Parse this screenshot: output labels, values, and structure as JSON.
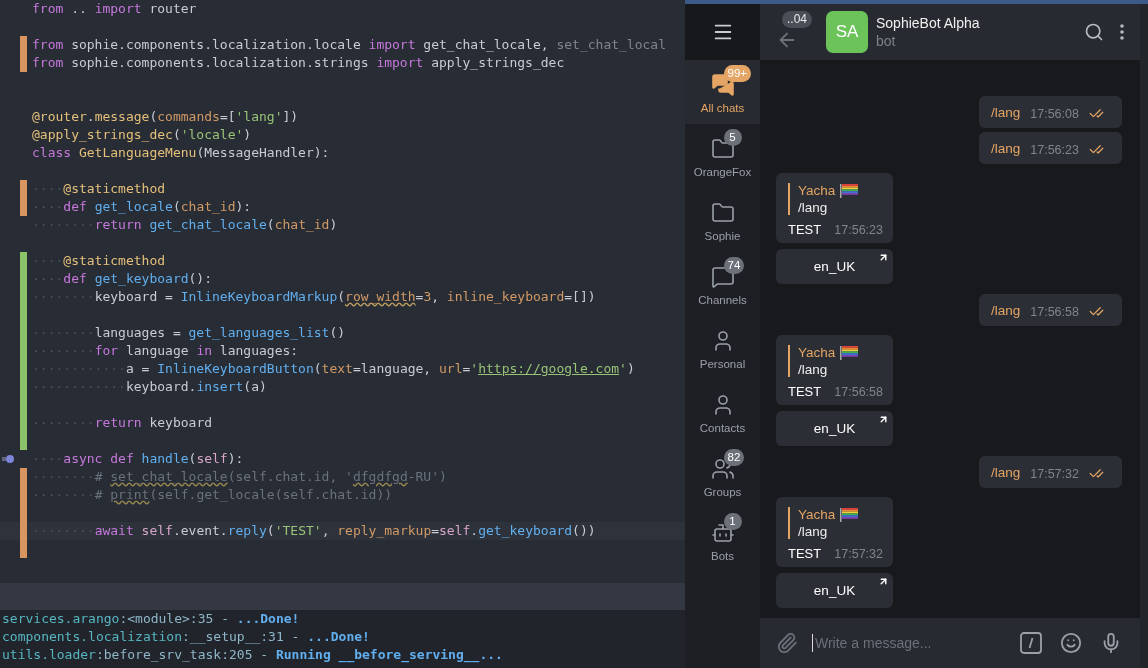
{
  "editor": {
    "lines": [
      {
        "kind": "unchanged",
        "tokens": [
          {
            "kind": "keyword",
            "text": "from"
          },
          {
            "kind": "name",
            "text": " .. "
          },
          {
            "kind": "keyword",
            "text": "import"
          },
          {
            "kind": "name",
            "text": " router"
          }
        ]
      },
      {
        "kind": "unchanged"
      },
      {
        "kind": "modified",
        "tokens": [
          {
            "kind": "keyword",
            "text": "from"
          },
          {
            "kind": "name",
            "text": " sophie.components.localization.locale "
          },
          {
            "kind": "keyword",
            "text": "import"
          },
          {
            "kind": "name",
            "text": " get_chat_locale, "
          },
          {
            "kind": "unused",
            "text": "set_chat_local"
          }
        ]
      },
      {
        "kind": "modified",
        "tokens": [
          {
            "kind": "keyword",
            "text": "from"
          },
          {
            "kind": "name",
            "text": " sophie.components.localization.strings "
          },
          {
            "kind": "keyword",
            "text": "import"
          },
          {
            "kind": "name",
            "text": " apply_strings_dec"
          }
        ]
      },
      {
        "kind": "unchanged"
      },
      {
        "kind": "unchanged"
      },
      {
        "kind": "unchanged",
        "tokens": [
          {
            "kind": "decorator",
            "text": "@router"
          },
          {
            "kind": "name",
            "text": "."
          },
          {
            "kind": "decorator",
            "text": "message"
          },
          {
            "kind": "name",
            "text": "("
          },
          {
            "kind": "parameter",
            "text": "commands"
          },
          {
            "kind": "name",
            "text": "=["
          },
          {
            "kind": "string",
            "text": "'lang'"
          },
          {
            "kind": "name",
            "text": "])"
          }
        ]
      },
      {
        "kind": "unchanged",
        "tokens": [
          {
            "kind": "decorator",
            "text": "@apply_strings_dec"
          },
          {
            "kind": "name",
            "text": "("
          },
          {
            "kind": "string",
            "text": "'locale'"
          },
          {
            "kind": "name",
            "text": ")"
          }
        ]
      },
      {
        "kind": "unchanged",
        "tokens": [
          {
            "kind": "keyword",
            "text": "class "
          },
          {
            "kind": "class",
            "text": "GetLanguageMenu"
          },
          {
            "kind": "name",
            "text": "(MessageHandler):"
          }
        ]
      },
      {
        "kind": "unchanged"
      },
      {
        "kind": "modified",
        "tokens": [
          {
            "kind": "indent",
            "text": "····"
          },
          {
            "kind": "decorator",
            "text": "@staticmethod"
          }
        ]
      },
      {
        "kind": "modified",
        "tokens": [
          {
            "kind": "indent",
            "text": "····"
          },
          {
            "kind": "keyword",
            "text": "def "
          },
          {
            "kind": "function",
            "text": "get_locale"
          },
          {
            "kind": "name",
            "text": "("
          },
          {
            "kind": "parameter",
            "text": "chat_id"
          },
          {
            "kind": "name",
            "text": "):"
          }
        ]
      },
      {
        "kind": "unchanged",
        "tokens": [
          {
            "kind": "indent",
            "text": "········"
          },
          {
            "kind": "keyword",
            "text": "return "
          },
          {
            "kind": "function",
            "text": "get_chat_locale"
          },
          {
            "kind": "name",
            "text": "("
          },
          {
            "kind": "parameter",
            "text": "chat_id"
          },
          {
            "kind": "name",
            "text": ")"
          }
        ]
      },
      {
        "kind": "unchanged"
      },
      {
        "kind": "added",
        "tokens": [
          {
            "kind": "indent",
            "text": "····"
          },
          {
            "kind": "decorator",
            "text": "@staticmethod"
          }
        ]
      },
      {
        "kind": "added",
        "tokens": [
          {
            "kind": "indent",
            "text": "····"
          },
          {
            "kind": "keyword",
            "text": "def "
          },
          {
            "kind": "function",
            "text": "get_keyboard"
          },
          {
            "kind": "name",
            "text": "():"
          }
        ]
      },
      {
        "kind": "added",
        "tokens": [
          {
            "kind": "indent",
            "text": "········"
          },
          {
            "kind": "name",
            "text": "keyboard = "
          },
          {
            "kind": "function",
            "text": "InlineKeyboardMarkup"
          },
          {
            "kind": "name",
            "text": "("
          },
          {
            "kind": "flagged_parameter",
            "text": "row_width"
          },
          {
            "kind": "name",
            "text": "="
          },
          {
            "kind": "parameter",
            "text": "3"
          },
          {
            "kind": "name",
            "text": ", "
          },
          {
            "kind": "parameter",
            "text": "inline_keyboard"
          },
          {
            "kind": "name",
            "text": "=[])"
          }
        ]
      },
      {
        "kind": "added"
      },
      {
        "kind": "added",
        "tokens": [
          {
            "kind": "indent",
            "text": "········"
          },
          {
            "kind": "name",
            "text": "languages = "
          },
          {
            "kind": "function",
            "text": "get_languages_list"
          },
          {
            "kind": "name",
            "text": "()"
          }
        ]
      },
      {
        "kind": "added",
        "tokens": [
          {
            "kind": "indent",
            "text": "········"
          },
          {
            "kind": "keyword",
            "text": "for"
          },
          {
            "kind": "name",
            "text": " language "
          },
          {
            "kind": "keyword",
            "text": "in"
          },
          {
            "kind": "name",
            "text": " languages:"
          }
        ]
      },
      {
        "kind": "added",
        "tokens": [
          {
            "kind": "indent",
            "text": "············"
          },
          {
            "kind": "name",
            "text": "a = "
          },
          {
            "kind": "function",
            "text": "InlineKeyboardButton"
          },
          {
            "kind": "name",
            "text": "("
          },
          {
            "kind": "parameter",
            "text": "text"
          },
          {
            "kind": "name",
            "text": "=language, "
          },
          {
            "kind": "parameter",
            "text": "url"
          },
          {
            "kind": "name",
            "text": "="
          },
          {
            "kind": "string",
            "text": "'"
          },
          {
            "kind": "link",
            "text": "https://google.com"
          },
          {
            "kind": "string",
            "text": "'"
          },
          {
            "kind": "name",
            "text": ")"
          }
        ]
      },
      {
        "kind": "added",
        "tokens": [
          {
            "kind": "indent",
            "text": "············"
          },
          {
            "kind": "name",
            "text": "keyboard."
          },
          {
            "kind": "function",
            "text": "insert"
          },
          {
            "kind": "name",
            "text": "(a)"
          }
        ]
      },
      {
        "kind": "added"
      },
      {
        "kind": "added",
        "tokens": [
          {
            "kind": "indent",
            "text": "········"
          },
          {
            "kind": "keyword",
            "text": "return"
          },
          {
            "kind": "name",
            "text": " keyboard"
          }
        ]
      },
      {
        "kind": "added"
      },
      {
        "kind": "unchanged",
        "gutter_marker": true,
        "tokens": [
          {
            "kind": "indent",
            "text": "····"
          },
          {
            "kind": "keyword",
            "text": "async def "
          },
          {
            "kind": "function",
            "text": "handle"
          },
          {
            "kind": "name",
            "text": "("
          },
          {
            "kind": "self",
            "text": "self"
          },
          {
            "kind": "name",
            "text": "):"
          }
        ]
      },
      {
        "kind": "modified",
        "tokens": [
          {
            "kind": "indent",
            "text": "········"
          },
          {
            "kind": "comment",
            "text": "# "
          },
          {
            "kind": "flagged_comment",
            "text": "set_chat_locale"
          },
          {
            "kind": "comment",
            "text": "(self.chat.id, '"
          },
          {
            "kind": "flagged_comment",
            "text": "dfgdfgd"
          },
          {
            "kind": "comment",
            "text": "-RU')"
          }
        ]
      },
      {
        "kind": "modified",
        "tokens": [
          {
            "kind": "indent",
            "text": "········"
          },
          {
            "kind": "comment",
            "text": "# "
          },
          {
            "kind": "flagged_comment",
            "text": "print"
          },
          {
            "kind": "comment",
            "text": "(self.get_locale(self.chat.id))"
          }
        ]
      },
      {
        "kind": "modified"
      },
      {
        "kind": "modified",
        "current": true,
        "tokens": [
          {
            "kind": "indent",
            "text": "········"
          },
          {
            "kind": "keyword",
            "text": "await "
          },
          {
            "kind": "self",
            "text": "self"
          },
          {
            "kind": "name",
            "text": ".event."
          },
          {
            "kind": "function",
            "text": "reply"
          },
          {
            "kind": "name",
            "text": "("
          },
          {
            "kind": "string",
            "text": "'TEST'"
          },
          {
            "kind": "name",
            "text": ", "
          },
          {
            "kind": "parameter",
            "text": "reply_markup"
          },
          {
            "kind": "name",
            "text": "="
          },
          {
            "kind": "self",
            "text": "self"
          },
          {
            "kind": "name",
            "text": "."
          },
          {
            "kind": "function",
            "text": "get_keyboard"
          },
          {
            "kind": "name",
            "text": "())"
          }
        ]
      },
      {
        "kind": "modified"
      }
    ]
  },
  "terminal": {
    "lines": [
      [
        {
          "kind": "source",
          "text": "services.arango"
        },
        {
          "kind": "detail",
          "text": ":<module>:35 - "
        },
        {
          "kind": "message",
          "text": "...Done!"
        }
      ],
      [
        {
          "kind": "source",
          "text": "components.localization"
        },
        {
          "kind": "detail",
          "text": ":__setup__:31 - "
        },
        {
          "kind": "message",
          "text": "...Done!"
        }
      ],
      [
        {
          "kind": "source",
          "text": "utils.loader"
        },
        {
          "kind": "detail",
          "text": ":before_srv_task:205 - "
        },
        {
          "kind": "message",
          "text": "Running __before_serving__..."
        }
      ]
    ]
  },
  "telegram": {
    "folders": [
      {
        "label": "All chats",
        "badge": "99+",
        "selected": true
      },
      {
        "label": "OrangeFox",
        "badge": "5",
        "selected": false
      },
      {
        "label": "Sophie",
        "selected": false
      },
      {
        "label": "Channels",
        "badge": "74",
        "selected": false
      },
      {
        "label": "Personal",
        "selected": false
      },
      {
        "label": "Contacts",
        "selected": false
      },
      {
        "label": "Groups",
        "badge": "82",
        "selected": false
      },
      {
        "label": "Bots",
        "badge": "1",
        "selected": false
      }
    ],
    "header": {
      "back_badge": "..04",
      "avatar": "SA",
      "title": "SophieBot Alpha",
      "subtitle": "bot"
    },
    "messages": [
      {
        "kind": "outgoing",
        "text": "/lang",
        "time": "17:56:08",
        "read": true
      },
      {
        "kind": "outgoing",
        "text": "/lang",
        "time": "17:56:23",
        "read": true
      },
      {
        "kind": "incoming",
        "reply_author": "Yacha",
        "reply_text": "/lang",
        "text": "TEST",
        "time": "17:56:23"
      },
      {
        "kind": "keyboard",
        "text": "en_UK"
      },
      {
        "kind": "outgoing",
        "text": "/lang",
        "time": "17:56:58",
        "read": true
      },
      {
        "kind": "incoming",
        "reply_author": "Yacha",
        "reply_text": "/lang",
        "text": "TEST",
        "time": "17:56:58"
      },
      {
        "kind": "keyboard",
        "text": "en_UK"
      },
      {
        "kind": "outgoing",
        "text": "/lang",
        "time": "17:57:32",
        "read": true
      },
      {
        "kind": "incoming",
        "reply_author": "Yacha",
        "reply_text": "/lang",
        "text": "TEST",
        "time": "17:57:32"
      },
      {
        "kind": "keyboard",
        "text": "en_UK"
      }
    ],
    "composer": {
      "placeholder": "Write a message..."
    }
  }
}
